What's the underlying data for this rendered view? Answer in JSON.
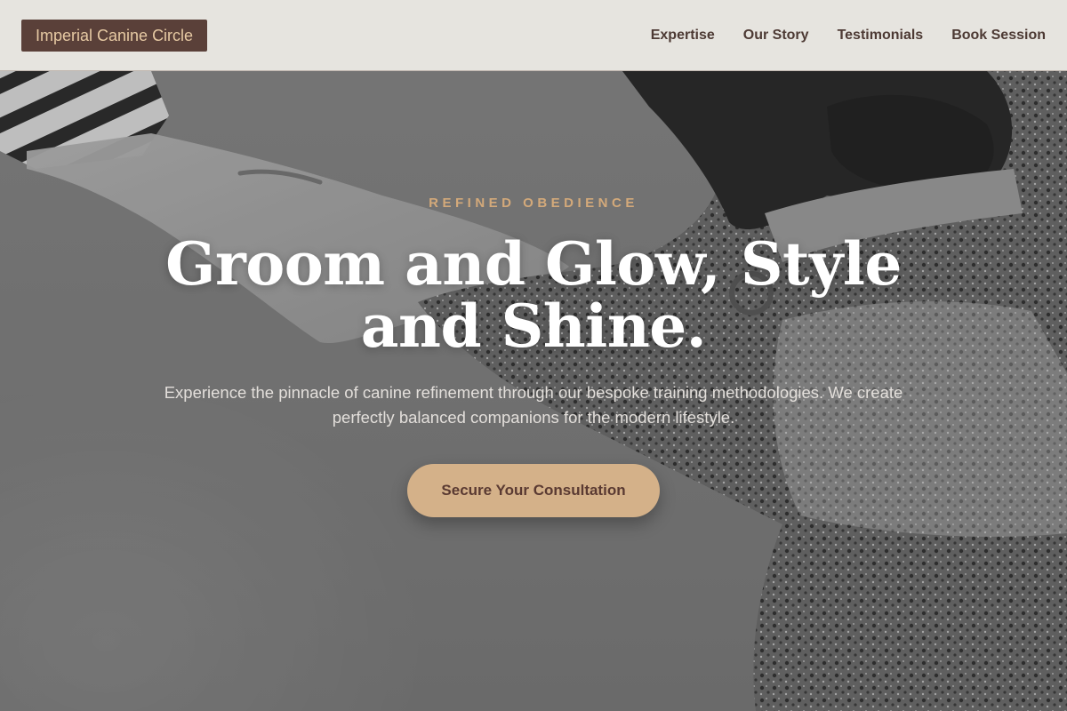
{
  "brand": {
    "name": "Imperial Canine Circle"
  },
  "nav": {
    "items": [
      {
        "label": "Expertise"
      },
      {
        "label": "Our Story"
      },
      {
        "label": "Testimonials"
      },
      {
        "label": "Book Session"
      }
    ]
  },
  "hero": {
    "eyebrow": "REFINED OBEDIENCE",
    "headline": "Groom and Glow, Style and Shine.",
    "subtext": "Experience the pinnacle of canine refinement through our bespoke training methodologies. We create perfectly balanced companions for the modern lifestyle.",
    "cta_label": "Secure Your Consultation",
    "image_subject": "person-hand-and-dog-paw-monochrome-photo"
  },
  "colors": {
    "brand_bg": "#5a4039",
    "brand_text": "#e6c9a3",
    "nav_text": "#4d3a34",
    "accent": "#d3a97a",
    "cta_bg": "#d4b189",
    "cta_text": "#5a3a32"
  }
}
